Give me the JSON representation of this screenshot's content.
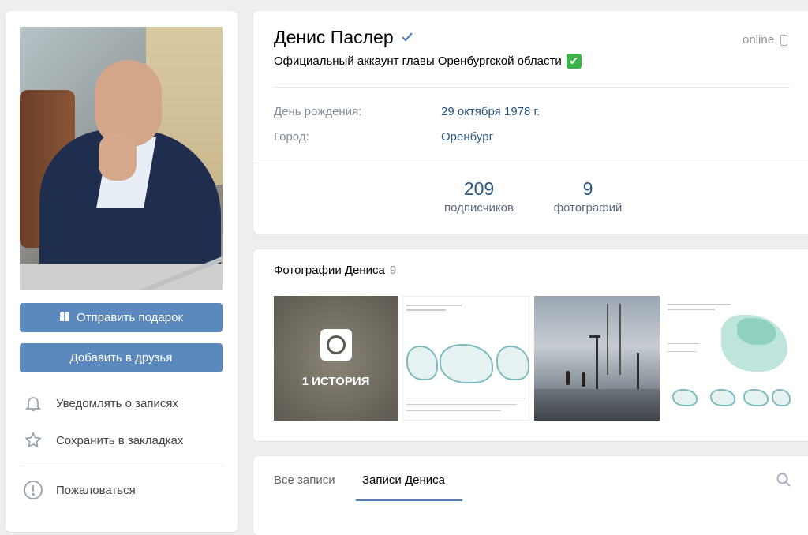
{
  "left": {
    "gift_button": "Отправить подарок",
    "add_friend_button": "Добавить в друзья",
    "actions": [
      {
        "icon": "bell-icon",
        "label": "Уведомлять о записях"
      },
      {
        "icon": "star-icon",
        "label": "Сохранить в закладках"
      },
      {
        "icon": "warning-icon",
        "label": "Пожаловаться"
      }
    ]
  },
  "profile": {
    "name": "Денис Паслер",
    "status": "Официальный аккаунт главы Оренбургской области",
    "online": "online",
    "birthday_label": "День рождения:",
    "birthday_value": "29 октября 1978 г.",
    "city_label": "Город:",
    "city_value": "Оренбург",
    "counters": [
      {
        "number": "209",
        "label": "подписчиков"
      },
      {
        "number": "9",
        "label": "фотографий"
      }
    ]
  },
  "photos": {
    "title": "Фотографии Дениса",
    "count": "9",
    "story_label": "1 ИСТОРИЯ"
  },
  "wall": {
    "tabs": [
      {
        "label": "Все записи",
        "active": false
      },
      {
        "label": "Записи Дениса",
        "active": true
      }
    ]
  },
  "colors": {
    "accent": "#5181b8",
    "button": "#5b88bd",
    "link": "#2a5885",
    "online_green": "#3bb34a"
  }
}
